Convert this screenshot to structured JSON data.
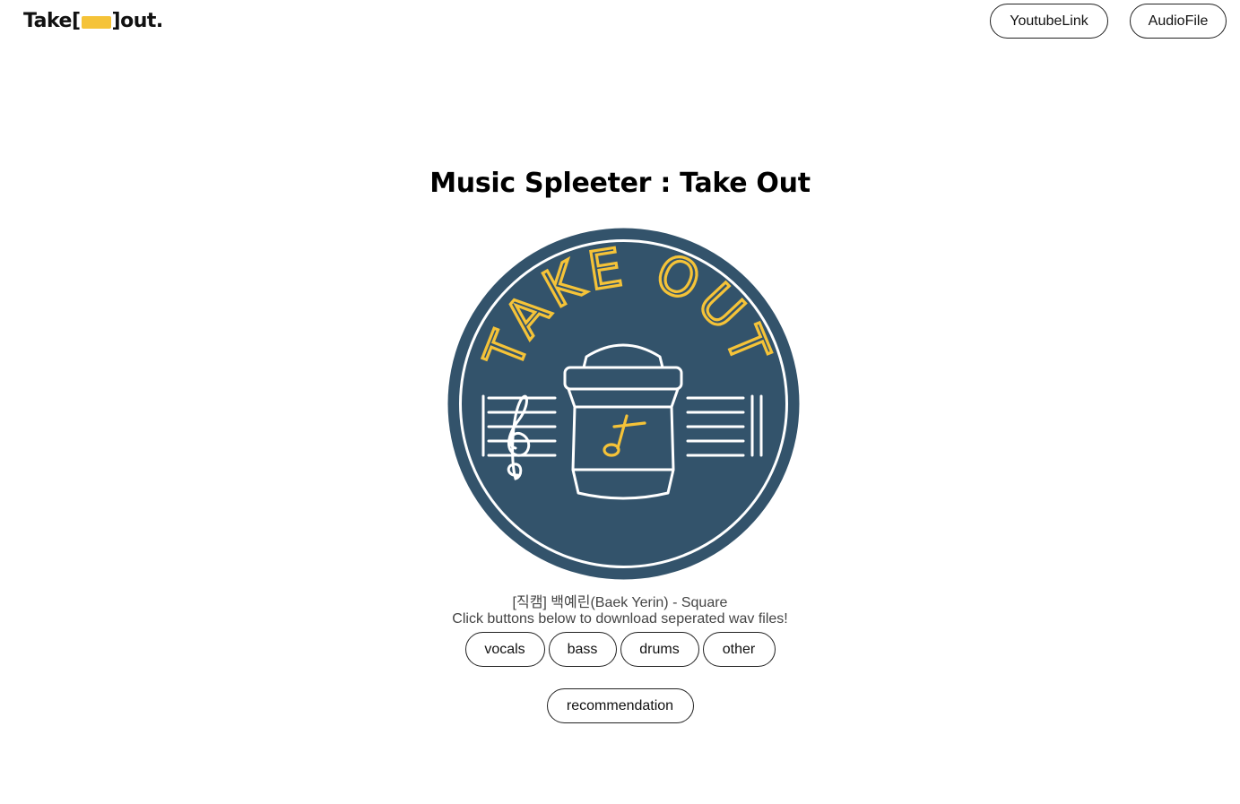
{
  "header": {
    "logo": {
      "left": "Take[",
      "right": "]out.",
      "accent": "#f5c338"
    },
    "nav": [
      {
        "label": "YoutubeLink"
      },
      {
        "label": "AudioFile"
      }
    ]
  },
  "main": {
    "title": "Music Spleeter : Take Out",
    "badge": {
      "text": "TAKE OUT",
      "icon": "coffee-cup-music-icon",
      "colors": {
        "background": "#33536b",
        "ring": "#ffffff",
        "text": "#f5c338"
      }
    },
    "song_title": "[직캠] 백예린(Baek Yerin) - Square",
    "hint": "Click buttons below to download seperated wav files!",
    "stems": [
      {
        "label": "vocals"
      },
      {
        "label": "bass"
      },
      {
        "label": "drums"
      },
      {
        "label": "other"
      }
    ],
    "recommendation_label": "recommendation"
  }
}
